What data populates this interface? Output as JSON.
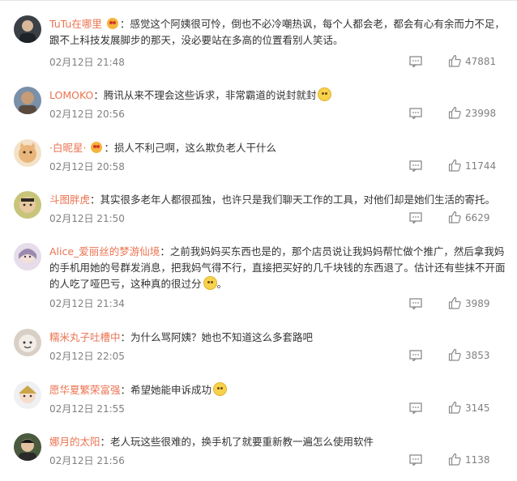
{
  "comments": [
    {
      "user": "TuTu在哪里",
      "text": "感觉这个阿姨很可怜，倒也不必冷嘲热讽，每个人都会老，都会有心有余而力不足，跟不上科技发展脚步的那天，没必要站在多高的位置看别人笑话。",
      "date": "02月12日 21:48",
      "likes": "47881"
    },
    {
      "user": "LOMOKO",
      "text": "腾讯从来不理会这些诉求，非常霸道的说封就封",
      "date": "02月12日 20:56",
      "likes": "23998"
    },
    {
      "user": "·白昵星·",
      "text": "损人不利己啊，这么欺负老人干什么",
      "date": "02月12日 20:58",
      "likes": "11744"
    },
    {
      "user": "斗图胖虎",
      "text": "其实很多老年人都很孤独，也许只是我们聊天工作的工具，对他们却是她们生活的寄托。",
      "date": "02月12日 21:50",
      "likes": "6629"
    },
    {
      "user": "Alice_爱丽丝的梦游仙境",
      "text": "之前我妈妈买东西也是的，那个店员说让我妈妈帮忙做个推广，然后拿我妈的手机用她的号群发消息，把我妈气得不行，直接把买好的几千块钱的东西退了。估计还有些抹不开面的人吃了哑巴亏，这种真的很过分",
      "date": "02月12日 21:34",
      "likes": "3989"
    },
    {
      "user": "糯米丸子吐槽中",
      "text": "为什么骂阿姨？她也不知道这么多套路吧",
      "date": "02月12日 22:05",
      "likes": "3853"
    },
    {
      "user": "愿华夏繁荣富强",
      "text": "希望她能申诉成功",
      "date": "02月12日 21:55",
      "likes": "3145"
    },
    {
      "user": "娜月的太阳",
      "text": "老人玩这些很难的，换手机了就要重新教一遍怎么使用软件",
      "date": "02月12日 21:56",
      "likes": "1138"
    }
  ],
  "icons": {
    "reply": "comment-icon",
    "like": "thumbs-up-icon"
  },
  "colors": {
    "username": "#eb7350",
    "meta": "#808080",
    "text": "#333333"
  }
}
